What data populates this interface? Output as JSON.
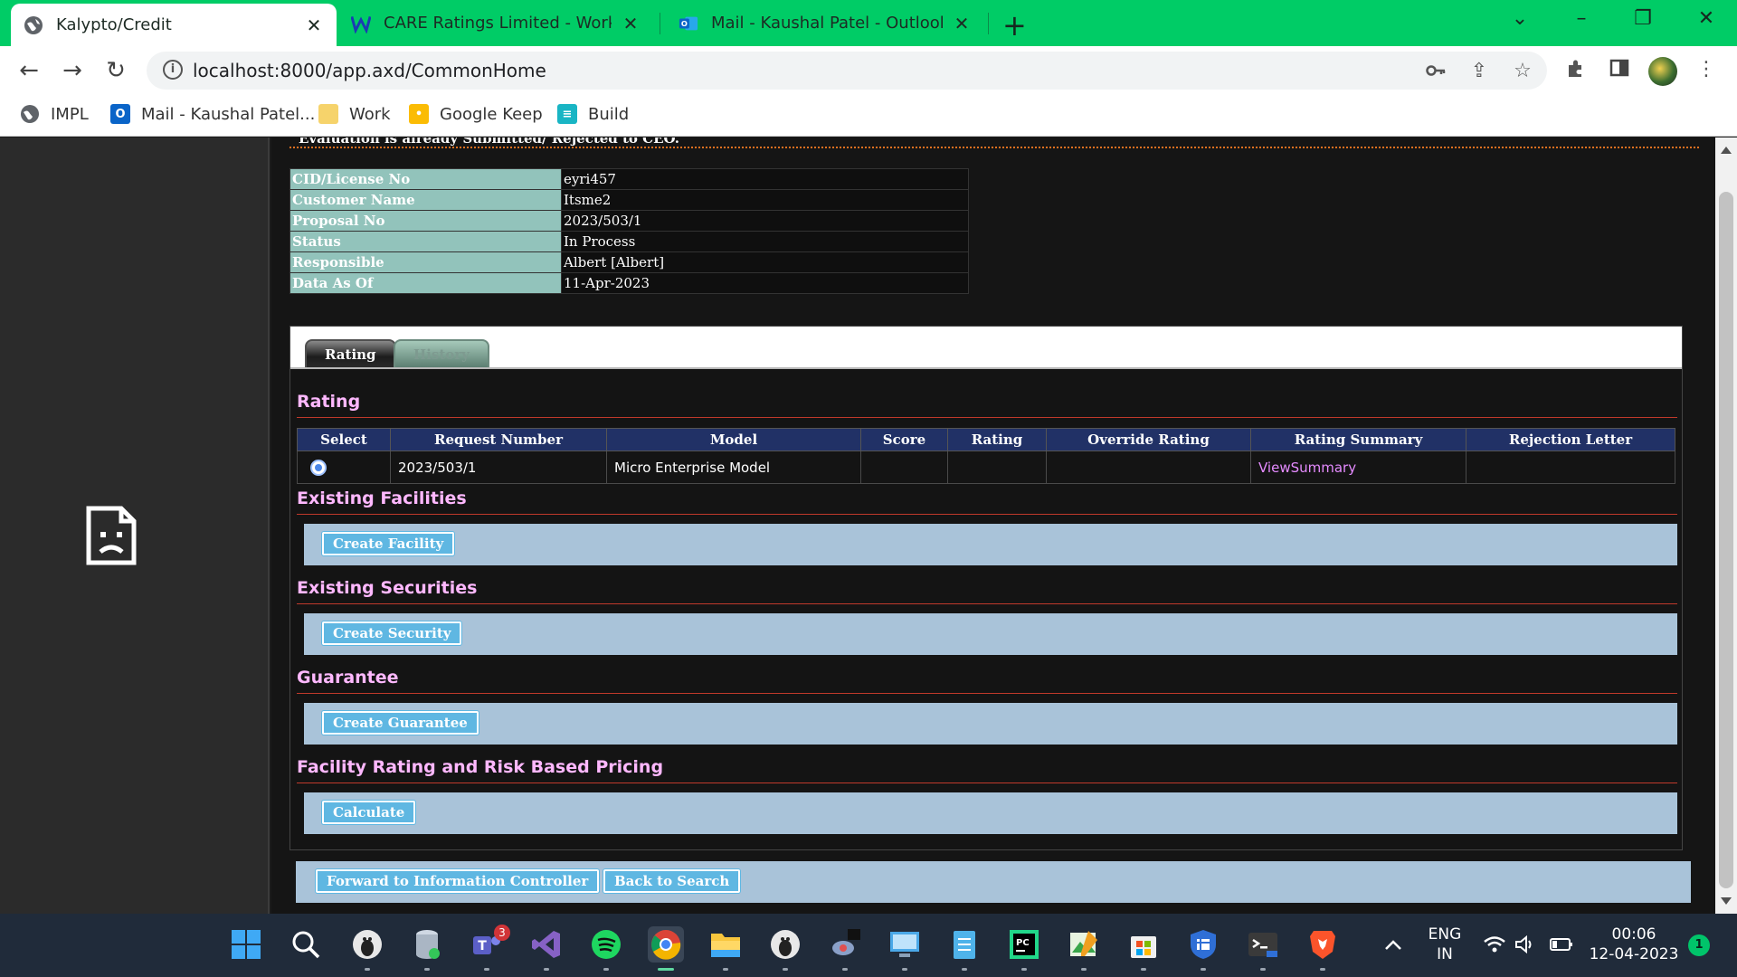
{
  "browser": {
    "tabs": [
      {
        "title": "Kalypto/Credit",
        "active": true
      },
      {
        "title": "CARE Ratings Limited - Workline",
        "active": false
      },
      {
        "title": "Mail - Kaushal Patel - Outlook",
        "active": false
      }
    ],
    "url": "localhost:8000/app.axd/CommonHome",
    "bookmarks": [
      {
        "label": "IMPL",
        "icon": "globe-icon"
      },
      {
        "label": "Mail - Kaushal Patel...",
        "icon": "outlook-icon"
      },
      {
        "label": "Work",
        "icon": "folder-icon"
      },
      {
        "label": "Google Keep",
        "icon": "keep-icon"
      },
      {
        "label": "Build",
        "icon": "build-icon"
      }
    ],
    "colors": {
      "tabbar": "#00cc66",
      "toolbar": "#ffffff"
    }
  },
  "page": {
    "notice": "Evaluation is already Submitted/ Rejected to CEO.",
    "info": [
      {
        "key": "CID/License No",
        "value": "eyri457"
      },
      {
        "key": "Customer Name",
        "value": "Itsme2"
      },
      {
        "key": "Proposal No",
        "value": "2023/503/1"
      },
      {
        "key": "Status",
        "value": "In Process"
      },
      {
        "key": "Responsible",
        "value": "Albert [Albert]"
      },
      {
        "key": "Data As Of",
        "value": "11-Apr-2023"
      }
    ],
    "tabs": [
      {
        "label": "Rating",
        "active": true
      },
      {
        "label": "History",
        "active": false
      }
    ],
    "rating": {
      "heading": "Rating",
      "columns": [
        "Select",
        "Request Number",
        "Model",
        "Score",
        "Rating",
        "Override Rating",
        "Rating Summary",
        "Rejection Letter"
      ],
      "rows": [
        {
          "selected": true,
          "request_number": "2023/503/1",
          "model": "Micro Enterprise Model",
          "score": "",
          "rating": "",
          "override_rating": "",
          "rating_summary": "ViewSummary",
          "rejection_letter": ""
        }
      ]
    },
    "sections": [
      {
        "heading": "Existing Facilities",
        "button": "Create Facility"
      },
      {
        "heading": "Existing Securities",
        "button": "Create Security"
      },
      {
        "heading": "Guarantee",
        "button": "Create Guarantee"
      },
      {
        "heading": "Facility Rating and Risk Based Pricing",
        "button": "Calculate"
      }
    ],
    "footer_buttons": {
      "forward": "Forward to Information Controller",
      "back": "Back to Search"
    },
    "colors": {
      "key_cell": "#92c3bb",
      "header": "#213166",
      "section_heading": "#ffb8ff",
      "button": "#5fb7e2",
      "bar": "#a9c3d9",
      "link": "#e58bff"
    }
  },
  "taskbar": {
    "teams_badge": "3",
    "language": "ENG",
    "region": "IN",
    "time": "00:06",
    "date": "12-04-2023",
    "notification_count": "1"
  }
}
